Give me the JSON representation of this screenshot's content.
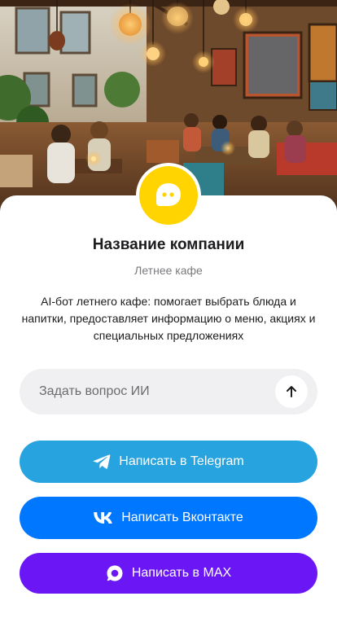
{
  "hero": {
    "image_icon": "cafe-interior-photo"
  },
  "company": {
    "name": "Название компании",
    "subtitle": "Летнее кафе",
    "description": "AI-бот летнего кафе: помогает выбрать блюда и напитки, предоставляет информацию о меню, акциях и специальных предложениях",
    "avatar_icon": "chat-bubble-icon",
    "avatar_color": "#FFD400"
  },
  "ask": {
    "placeholder": "Задать вопрос ИИ",
    "value": "",
    "send_icon": "arrow-up-icon"
  },
  "buttons": {
    "telegram": {
      "label": "Написать в Telegram",
      "icon": "telegram-icon",
      "color": "#27A3E0"
    },
    "vk": {
      "label": "Написать Вконтакте",
      "icon": "vk-icon",
      "color": "#0077FF"
    },
    "max": {
      "label": "Написать в MAX",
      "icon": "max-icon",
      "color": "#6B16F5"
    }
  }
}
